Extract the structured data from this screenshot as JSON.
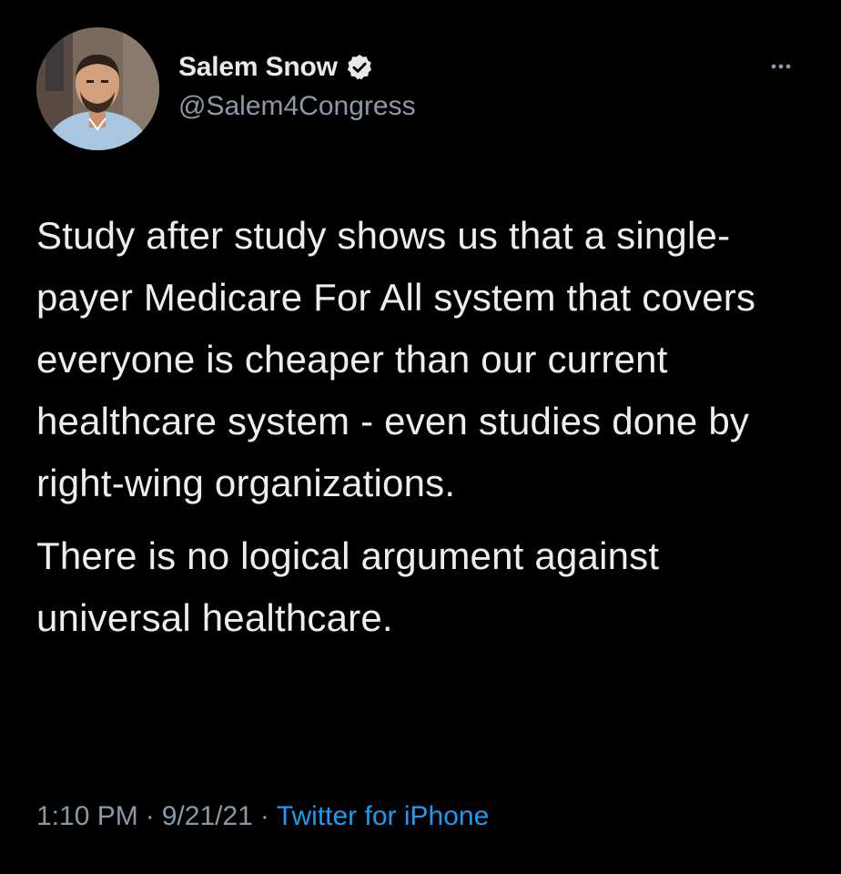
{
  "author": {
    "display_name": "Salem Snow",
    "handle": "@Salem4Congress",
    "verified_icon": "verified-badge-icon",
    "avatar_icon": "profile-photo"
  },
  "menu": {
    "more_icon": "more-options-icon"
  },
  "tweet": {
    "paragraphs": [
      "Study after study shows us that a single-payer Medicare For All system that covers everyone is cheaper than our current healthcare system - even studies done by right-wing organizations.",
      "There is no logical argument against universal healthcare."
    ]
  },
  "meta": {
    "time": "1:10 PM",
    "separator": "·",
    "date": "9/21/21",
    "source": "Twitter for iPhone"
  },
  "colors": {
    "background": "#000000",
    "text": "#e7e9ea",
    "secondary": "#8b98a5",
    "link": "#1d9bf0"
  }
}
